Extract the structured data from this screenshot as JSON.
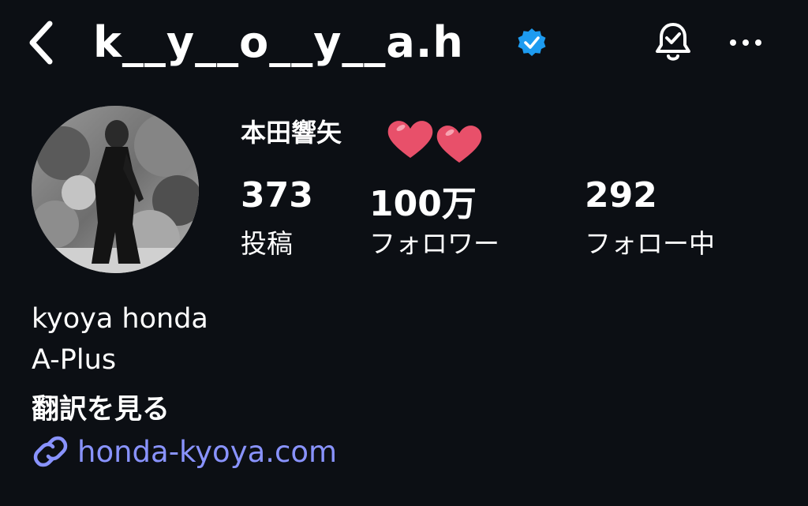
{
  "header": {
    "username": "k__y__o__y__a.h",
    "back_icon": "chevron-left-icon",
    "verified_icon": "verified-badge-icon",
    "bell_icon": "bell-check-icon",
    "more_icon": "more-horizontal-icon"
  },
  "profile": {
    "display_name": "本田響矢",
    "stats": {
      "posts": {
        "value": "373",
        "label": "投稿"
      },
      "followers": {
        "value": "100万",
        "label": "フォロワー"
      },
      "following": {
        "value": "292",
        "label": "フォロー中"
      }
    },
    "bio": {
      "name": "kyoya honda",
      "agency": "A-Plus",
      "translate": "翻訳を見る"
    },
    "link": {
      "text": "honda-kyoya.com",
      "icon": "link-icon"
    }
  },
  "colors": {
    "background": "#0c0f14",
    "text": "#ffffff",
    "link": "#8993ff",
    "verified": "#1d9bf0",
    "heart": "#e8506a"
  }
}
